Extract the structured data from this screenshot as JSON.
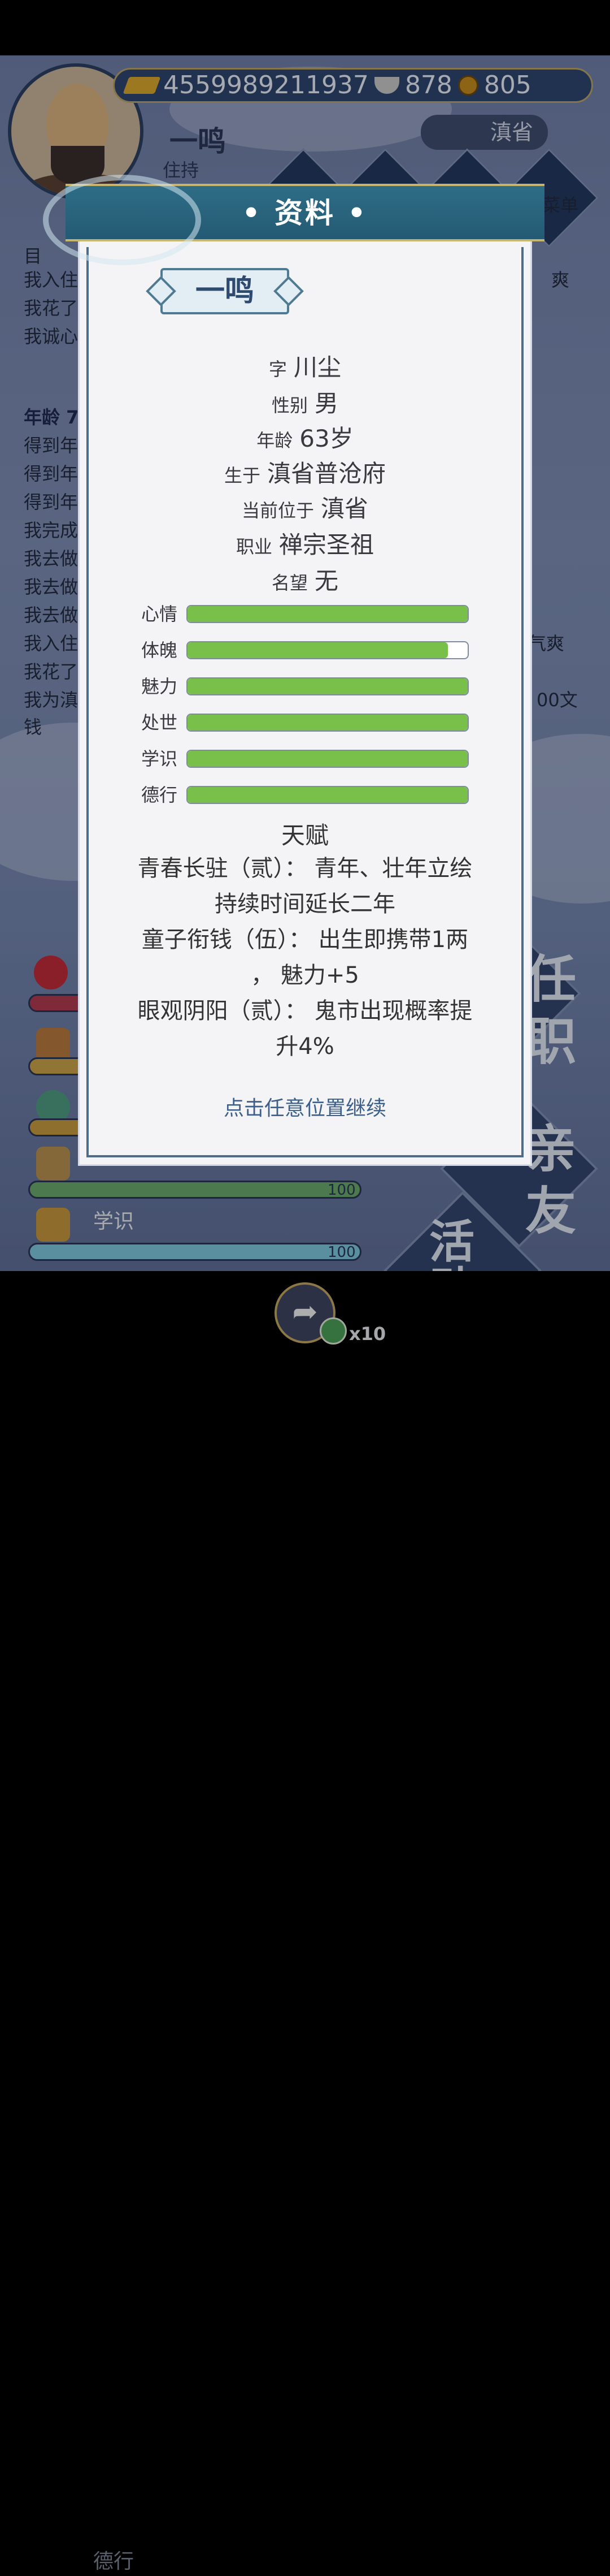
{
  "currency": {
    "gold": "4559989211937",
    "silver": "878",
    "coins": "805"
  },
  "background": {
    "character_name": "一鸣",
    "character_title": "住持",
    "location": "滇省",
    "menu_label": "菜单",
    "log_lines_top": [
      "目",
      "我入住",
      "我花了",
      "我诚心"
    ],
    "log_right_1": "爽",
    "age_heading": "年龄 7",
    "log_lines": [
      "得到年",
      "得到年",
      "得到年",
      "我完成",
      "我去做",
      "我去做",
      "我去做",
      "我入住",
      "我花了",
      "我为滇",
      "钱"
    ],
    "log_right_2": "气爽",
    "log_right_3": "00文",
    "stat_value": "100",
    "stat_learning": "学识",
    "stat_virtue": "德行",
    "side_buttons": [
      "任职",
      "亲友",
      "活动"
    ]
  },
  "bottom_bar": {
    "share_count": "x10"
  },
  "dialog": {
    "title": "• 资料 •",
    "name": "一鸣",
    "info": [
      {
        "label": "字",
        "value": "川尘"
      },
      {
        "label": "性别",
        "value": "男"
      },
      {
        "label": "年龄",
        "value": "63岁"
      },
      {
        "label": "生于",
        "value": "滇省普沧府"
      },
      {
        "label": "当前位于",
        "value": "滇省"
      },
      {
        "label": "职业",
        "value": "禅宗圣祖"
      },
      {
        "label": "名望",
        "value": "无"
      }
    ],
    "stats": [
      {
        "label": "心情",
        "fill": 1.0
      },
      {
        "label": "体魄",
        "fill": 0.93
      },
      {
        "label": "魅力",
        "fill": 1.0
      },
      {
        "label": "处世",
        "fill": 1.0
      },
      {
        "label": "学识",
        "fill": 1.0
      },
      {
        "label": "德行",
        "fill": 1.0
      }
    ],
    "stat_fill_color": "#78c04a",
    "talent_heading": "天赋",
    "talent_lines": [
      "青春长驻（贰）： 青年、壮年立绘",
      "持续时间延长二年",
      "童子衔钱（伍）： 出生即携带1两",
      "， 魅力+5",
      "眼观阴阳（贰）： 鬼市出现概率提",
      "升4%"
    ],
    "continue_hint": "点击任意位置继续"
  }
}
